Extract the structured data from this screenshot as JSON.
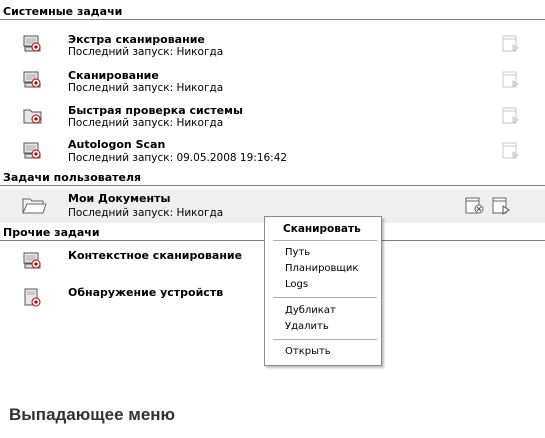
{
  "sections": {
    "system": "Системные задачи",
    "user": "Задачи пользователя",
    "other": "Прочие задачи"
  },
  "system_tasks": [
    {
      "name": "Экстра сканирование",
      "last_run": "Последний запуск: Никогда",
      "icon": "scan-icon"
    },
    {
      "name": "Сканирование",
      "last_run": "Последний запуск: Никогда",
      "icon": "scan-icon"
    },
    {
      "name": "Быстрая проверка системы",
      "last_run": "Последний запуск: Никогда",
      "icon": "quick-check-icon"
    },
    {
      "name": "Autologon Scan",
      "last_run": "Последний запуск: 09.05.2008 19:16:42",
      "icon": "scan-icon"
    }
  ],
  "user_tasks": [
    {
      "name": "Мои Документы",
      "last_run": "Последний запуск: Никогда",
      "icon": "folder-icon"
    }
  ],
  "other_tasks": [
    {
      "name": "Контекстное сканирование",
      "icon": "scan-icon"
    },
    {
      "name": "Обнаружение устройств",
      "icon": "device-icon"
    }
  ],
  "context_menu": {
    "scan": "Сканировать",
    "path": "Путь",
    "scheduler": "Планировщик",
    "logs": "Logs",
    "duplicate": "Дубликат",
    "delete": "Удалить",
    "open": "Открыть"
  },
  "caption": "Выпадающее меню"
}
